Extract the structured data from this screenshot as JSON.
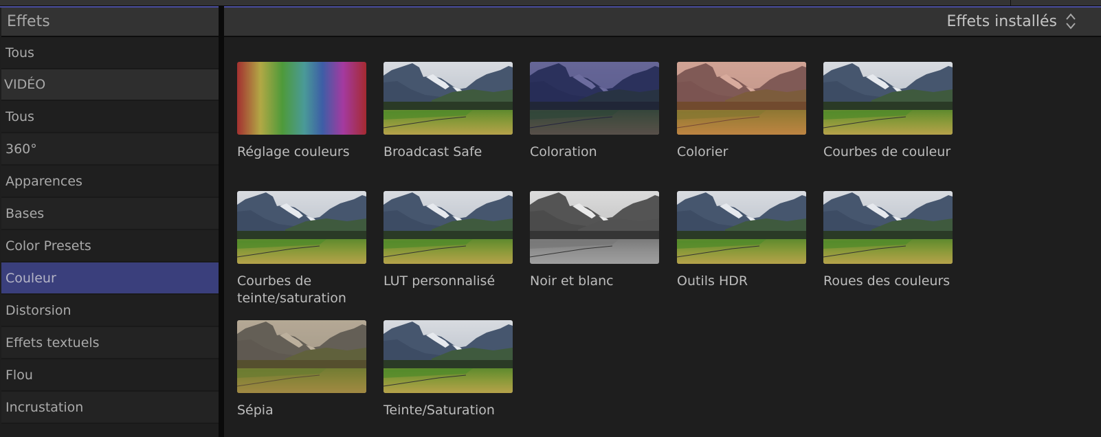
{
  "header": {
    "panel_title": "Effets",
    "sort_selector": {
      "label": "Effets installés",
      "icon": "updown-chevron-icon"
    }
  },
  "sidebar": {
    "items": [
      {
        "label": "Tous",
        "type": "item",
        "selected": false
      },
      {
        "label": "VIDÉO",
        "type": "section",
        "selected": false
      },
      {
        "label": "Tous",
        "type": "item",
        "selected": false
      },
      {
        "label": "360°",
        "type": "item",
        "selected": false
      },
      {
        "label": "Apparences",
        "type": "item",
        "selected": false
      },
      {
        "label": "Bases",
        "type": "item",
        "selected": false
      },
      {
        "label": "Color Presets",
        "type": "item",
        "selected": false
      },
      {
        "label": "Couleur",
        "type": "item",
        "selected": true
      },
      {
        "label": "Distorsion",
        "type": "item",
        "selected": false
      },
      {
        "label": "Effets textuels",
        "type": "item",
        "selected": false
      },
      {
        "label": "Flou",
        "type": "item",
        "selected": false
      },
      {
        "label": "Incrustation",
        "type": "item",
        "selected": false
      }
    ]
  },
  "effects": [
    {
      "label": "Réglage couleurs",
      "thumbnail": "rainbow-gradient"
    },
    {
      "label": "Broadcast Safe",
      "thumbnail": "landscape-normal"
    },
    {
      "label": "Coloration",
      "thumbnail": "landscape-indigo-tint"
    },
    {
      "label": "Colorier",
      "thumbnail": "landscape-red-tint"
    },
    {
      "label": "Courbes de couleur",
      "thumbnail": "landscape-normal"
    },
    {
      "label": "Courbes de teinte/saturation",
      "thumbnail": "landscape-normal"
    },
    {
      "label": "LUT personnalisé",
      "thumbnail": "landscape-normal"
    },
    {
      "label": "Noir et blanc",
      "thumbnail": "landscape-grayscale"
    },
    {
      "label": "Outils HDR",
      "thumbnail": "landscape-normal"
    },
    {
      "label": "Roues des couleurs",
      "thumbnail": "landscape-normal"
    },
    {
      "label": "Sépia",
      "thumbnail": "landscape-sepia"
    },
    {
      "label": "Teinte/Saturation",
      "thumbnail": "landscape-normal"
    }
  ],
  "colors": {
    "selection": "#3a3f7c",
    "accent_line": "#4a4fa0",
    "background": "#1e1e1e"
  }
}
